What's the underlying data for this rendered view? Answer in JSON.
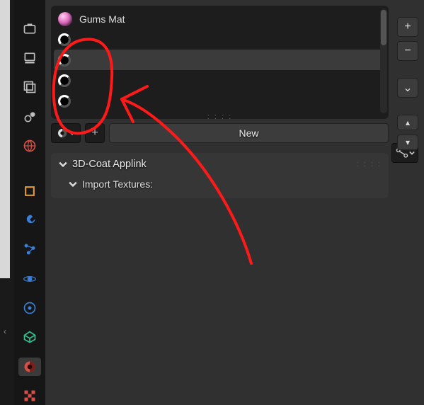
{
  "material_list": {
    "slots": [
      {
        "name": "Gums Mat",
        "has_preview_sphere": true
      },
      {
        "name": "",
        "has_preview_sphere": false
      },
      {
        "name": "",
        "has_preview_sphere": false
      },
      {
        "name": "",
        "has_preview_sphere": false
      },
      {
        "name": "",
        "has_preview_sphere": false
      }
    ],
    "selected_index": 2
  },
  "selector": {
    "new_label": "New",
    "add_glyph": "+"
  },
  "side_buttons": {
    "add": "+",
    "remove": "−",
    "menu": "⌄",
    "move_up": "▴",
    "move_down": "▾"
  },
  "panel": {
    "title": "3D-Coat Applink",
    "sub_title": "Import Textures:"
  },
  "tabs": [
    {
      "id": "render",
      "color": "#bdbdbd"
    },
    {
      "id": "output",
      "color": "#bdbdbd"
    },
    {
      "id": "viewlayer",
      "color": "#bdbdbd"
    },
    {
      "id": "scene",
      "color": "#bdbdbd"
    },
    {
      "id": "world",
      "color": "#d94f46"
    },
    {
      "id": "object",
      "color": "#e39b3a"
    },
    {
      "id": "modifiers",
      "color": "#3a7fd9"
    },
    {
      "id": "particles",
      "color": "#3a7fd9"
    },
    {
      "id": "physics",
      "color": "#3a7fd9"
    },
    {
      "id": "constraints",
      "color": "#3a7fd9"
    },
    {
      "id": "data",
      "color": "#33c08f"
    },
    {
      "id": "material",
      "color": "#d94f46",
      "active": true
    },
    {
      "id": "texture",
      "color": "#d94f46"
    }
  ],
  "annotation": {
    "stroke": "#ff1a1a",
    "stroke_width": 4
  }
}
